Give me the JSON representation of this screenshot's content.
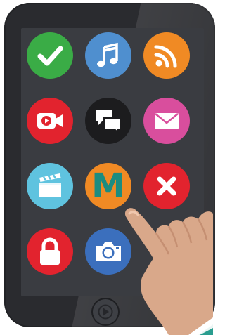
{
  "apps": [
    {
      "name": "checkmark",
      "icon": "checkmark-icon",
      "color": "#3aac46"
    },
    {
      "name": "music",
      "icon": "music-note-icon",
      "color": "#4f8fcf"
    },
    {
      "name": "rss",
      "icon": "rss-feed-icon",
      "color": "#f08a24"
    },
    {
      "name": "video",
      "icon": "video-camera-icon",
      "color": "#e2232e"
    },
    {
      "name": "chat",
      "icon": "chat-bubbles-icon",
      "color": "#1c1c1e"
    },
    {
      "name": "mail",
      "icon": "envelope-icon",
      "color": "#d94e9d"
    },
    {
      "name": "movie",
      "icon": "clapperboard-icon",
      "color": "#5fc3df"
    },
    {
      "name": "m-app",
      "label": "M",
      "color": "#f08a24"
    },
    {
      "name": "close",
      "icon": "close-x-icon",
      "color": "#e2232e"
    },
    {
      "name": "lock",
      "icon": "padlock-icon",
      "color": "#e2232e"
    },
    {
      "name": "camera",
      "icon": "camera-icon",
      "color": "#3b6fbd"
    }
  ],
  "device": {
    "body_color": "#2a2b2f",
    "screen_color": "#3a3c41",
    "home_button_icon": "play-triangle-icon"
  },
  "hand_color": "#d9a88a",
  "sleeve_color": "#2a9d8f"
}
